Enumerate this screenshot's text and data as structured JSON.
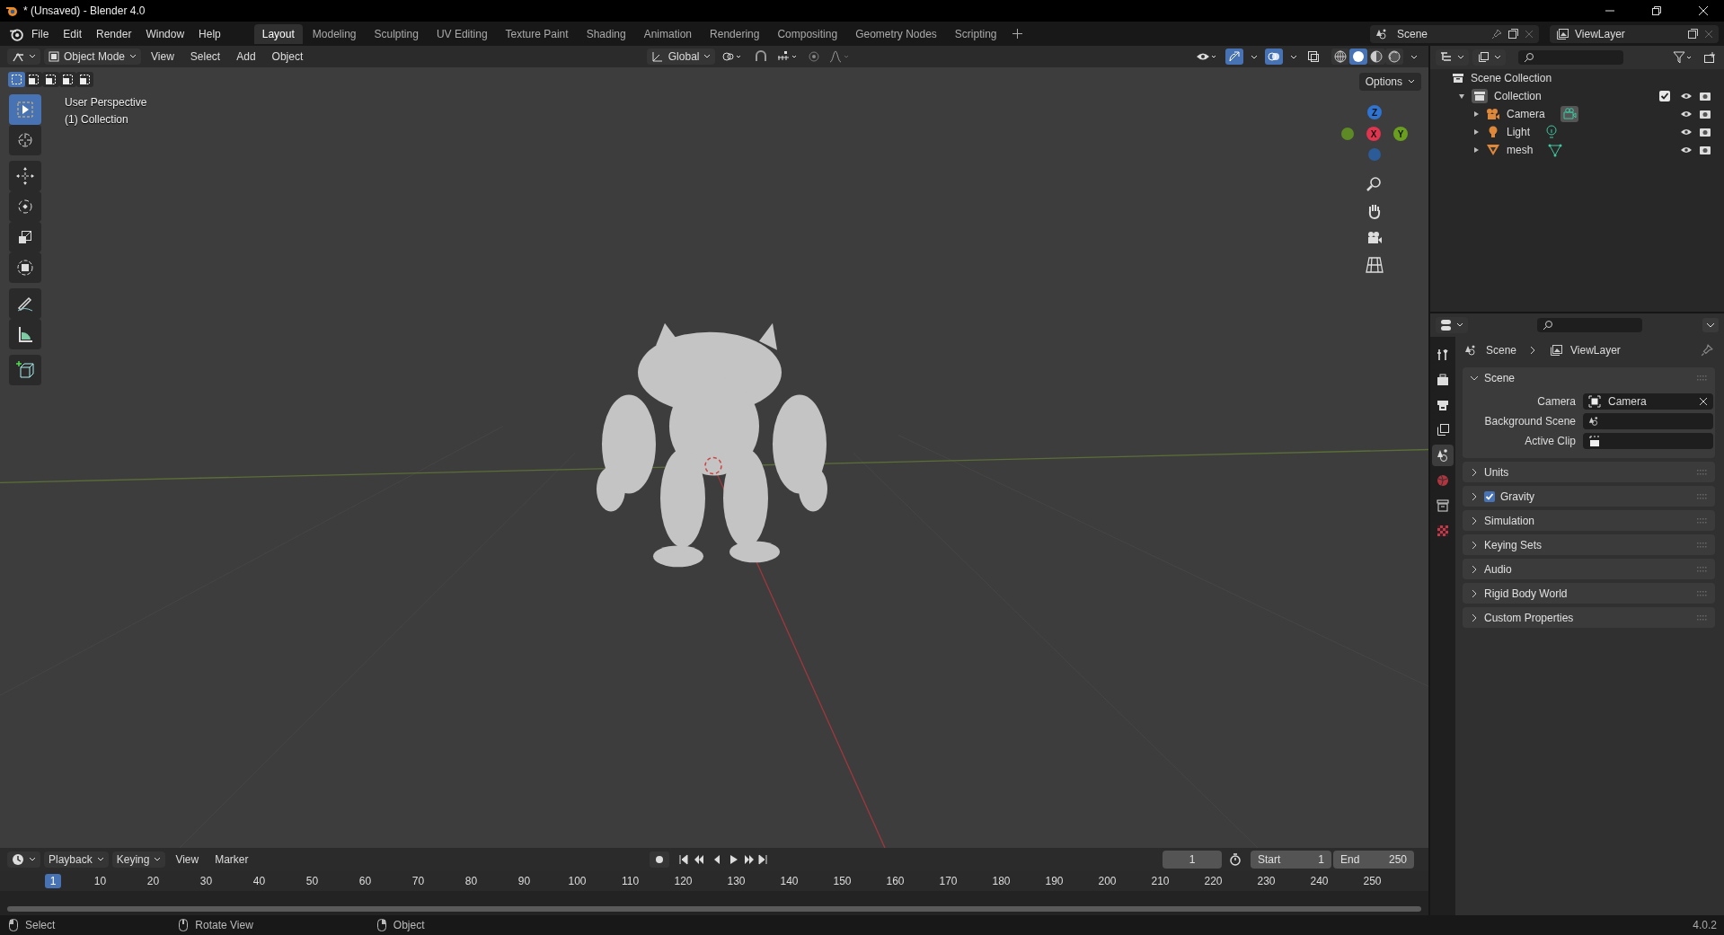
{
  "window": {
    "title": "* (Unsaved) - Blender 4.0"
  },
  "menu": [
    "File",
    "Edit",
    "Render",
    "Window",
    "Help"
  ],
  "workspaces": [
    {
      "label": "Layout",
      "selected": true
    },
    {
      "label": "Modeling",
      "selected": false
    },
    {
      "label": "Sculpting",
      "selected": false
    },
    {
      "label": "UV Editing",
      "selected": false
    },
    {
      "label": "Texture Paint",
      "selected": false
    },
    {
      "label": "Shading",
      "selected": false
    },
    {
      "label": "Animation",
      "selected": false
    },
    {
      "label": "Rendering",
      "selected": false
    },
    {
      "label": "Compositing",
      "selected": false
    },
    {
      "label": "Geometry Nodes",
      "selected": false
    },
    {
      "label": "Scripting",
      "selected": false
    }
  ],
  "scene_selector": {
    "value": "Scene"
  },
  "view_layer_selector": {
    "value": "ViewLayer"
  },
  "viewport": {
    "mode": "Object Mode",
    "menus": [
      "View",
      "Select",
      "Add",
      "Object"
    ],
    "orientation": "Global",
    "options": "Options",
    "overlay_text": [
      "User Perspective",
      "(1) Collection"
    ],
    "select_modes": [
      {
        "selected": true
      },
      {
        "selected": false
      },
      {
        "selected": false
      },
      {
        "selected": false
      },
      {
        "selected": false
      }
    ],
    "shading_modes": [
      {
        "kind": "wireframe",
        "selected": false
      },
      {
        "kind": "solid",
        "selected": true
      },
      {
        "kind": "material",
        "selected": false
      },
      {
        "kind": "rendered",
        "selected": false
      }
    ],
    "tool_groups": [
      {
        "tools": [
          {
            "kind": "select",
            "selected": true
          },
          {
            "kind": "cursor",
            "selected": false
          }
        ]
      },
      {
        "tools": [
          {
            "kind": "move",
            "selected": false
          },
          {
            "kind": "rotate",
            "selected": false
          },
          {
            "kind": "scale",
            "selected": false
          },
          {
            "kind": "transform",
            "selected": false
          }
        ]
      },
      {
        "tools": [
          {
            "kind": "annotate",
            "selected": false
          },
          {
            "kind": "measure",
            "selected": false
          }
        ]
      },
      {
        "tools": [
          {
            "kind": "add-cube",
            "selected": false
          }
        ]
      }
    ],
    "gizmo_axes": [
      {
        "label": "Z",
        "color": "#2e74d0"
      },
      {
        "label": "Y",
        "color": "#6a9e1f"
      },
      {
        "label": "X",
        "color": "#e0344f"
      }
    ]
  },
  "outliner": {
    "root": "Scene Collection",
    "items": [
      {
        "name": "Collection",
        "expanded": true,
        "checked": true,
        "children": [
          {
            "name": "Camera",
            "kind": "camera",
            "expanded": false
          },
          {
            "name": "Light",
            "kind": "light",
            "expanded": false
          },
          {
            "name": "mesh",
            "kind": "mesh",
            "expanded": false
          }
        ]
      }
    ]
  },
  "properties": {
    "breadcrumb": [
      "Scene",
      "ViewLayer"
    ],
    "tabs": [
      {
        "kind": "tool",
        "selected": false
      },
      {
        "kind": "render",
        "selected": false
      },
      {
        "kind": "output",
        "selected": false
      },
      {
        "kind": "view-layer",
        "selected": false
      },
      {
        "kind": "scene",
        "selected": true
      },
      {
        "kind": "world",
        "selected": false
      },
      {
        "kind": "collection",
        "selected": false
      },
      {
        "kind": "texture",
        "selected": false
      }
    ],
    "panels": [
      {
        "title": "Scene",
        "kind": "plain",
        "expanded": true,
        "fields": [
          {
            "label": "Camera",
            "kind": "camera",
            "value": "Camera"
          },
          {
            "label": "Background Scene",
            "kind": "scene"
          },
          {
            "label": "Active Clip",
            "kind": "clip"
          }
        ]
      },
      {
        "title": "Units",
        "kind": "plain",
        "expanded": false
      },
      {
        "title": "Gravity",
        "kind": "toggle",
        "checked": true,
        "expanded": false
      },
      {
        "title": "Simulation",
        "kind": "plain",
        "expanded": false
      },
      {
        "title": "Keying Sets",
        "kind": "plain",
        "expanded": false
      },
      {
        "title": "Audio",
        "kind": "plain",
        "expanded": false
      },
      {
        "title": "Rigid Body World",
        "kind": "plain",
        "expanded": false
      },
      {
        "title": "Custom Properties",
        "kind": "plain",
        "expanded": false
      }
    ]
  },
  "timeline": {
    "menus": [
      "Playback",
      "Keying",
      "View",
      "Marker"
    ],
    "current_frame": "1",
    "start": {
      "label": "Start",
      "value": "1"
    },
    "end": {
      "label": "End",
      "value": "250"
    },
    "playhead": "1",
    "ticks": [
      "10",
      "20",
      "30",
      "40",
      "50",
      "60",
      "70",
      "80",
      "90",
      "100",
      "110",
      "120",
      "130",
      "140",
      "150",
      "160",
      "170",
      "180",
      "190",
      "200",
      "210",
      "220",
      "230",
      "240",
      "250"
    ]
  },
  "status_bar": {
    "hints": [
      {
        "kind": "left",
        "label": "Select"
      },
      {
        "kind": "middle",
        "label": "Rotate View"
      },
      {
        "kind": "right",
        "label": "Object"
      }
    ],
    "version": "4.0.2"
  }
}
